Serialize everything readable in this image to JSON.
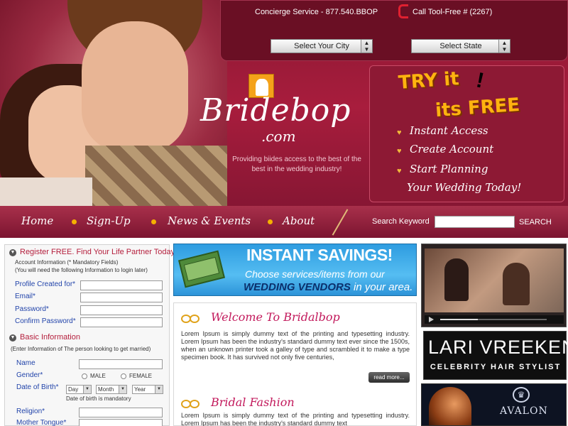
{
  "header": {
    "concierge": "Concierge Service - 877.540.BBOP",
    "tollfree": "Call Tool-Free #  (2267)",
    "select_city": "Select Your City",
    "select_state": "Select State",
    "logo_title": "Bridebop",
    "logo_sub": ".com",
    "tagline": "Providing biides access to the best of the best in the wedding industry!"
  },
  "promo": {
    "try_line1": "TRY it",
    "try_line2": "its FREE",
    "items": [
      "Instant Access",
      "Create Account",
      "Start Planning",
      "Your Wedding Today!"
    ]
  },
  "nav": {
    "items": [
      "Home",
      "Sign-Up",
      "News & Events",
      "About"
    ],
    "search_label": "Search Keyword",
    "search_button": "SEARCH",
    "search_value": ""
  },
  "form": {
    "register_head": "Register FREE. Find Your Life Partner Today!",
    "account_info": "Account Information  (* Mandatory Fields)",
    "account_note": "(You will need the following Information to login later)",
    "fields": [
      "Profile Created for*",
      "Email*",
      "Password*",
      "Confirm Password*"
    ],
    "basic_head": "Basic Information",
    "basic_note": "(Enter Information of The person looking to get married)",
    "name_label": "Name",
    "gender_label": "Gender*",
    "gender_options": [
      "MALE",
      "FEMALE"
    ],
    "dob_label": "Date of Birth*",
    "dob_day": "Day",
    "dob_month": "Month",
    "dob_year": "Year",
    "dob_note": "Date of birth is mandatory",
    "religion_label": "Religion*",
    "mother_tongue_label": "Mother Tongue*"
  },
  "banner": {
    "headline": "INSTANT SAVINGS!",
    "line1": "Choose services/items from our",
    "line2_bold": "WEDDING VENDORS",
    "line2_rest": " in your area."
  },
  "main": {
    "welcome_title": "Welcome To Bridalbop",
    "welcome_text": "Lorem Ipsum is simply dummy text of the printing and typesetting industry. Lorem Ipsum has been the industry's standard dummy text ever since the 1500s, when an unknown printer took a galley of type and scrambled it to make a type specimen book. It has survived not only five centuries,",
    "read_more": "read more...",
    "fashion_title": "Bridal Fashion",
    "fashion_text": "Lorem Ipsum is simply dummy text of the printing and typesetting industry. Lorem Ipsum has been the industry's standard dummy text"
  },
  "sidebar": {
    "video_progress": 0.35,
    "lari_name": "LARI VREEKEN",
    "lari_sub": "CELEBRITY HAIR STYLIST",
    "avalon_name": "AVALON"
  },
  "colors": {
    "brand_maroon": "#a81d3d",
    "accent_gold": "#ffb30f",
    "link_blue": "#2244aa",
    "heading_red": "#b41e3c"
  }
}
